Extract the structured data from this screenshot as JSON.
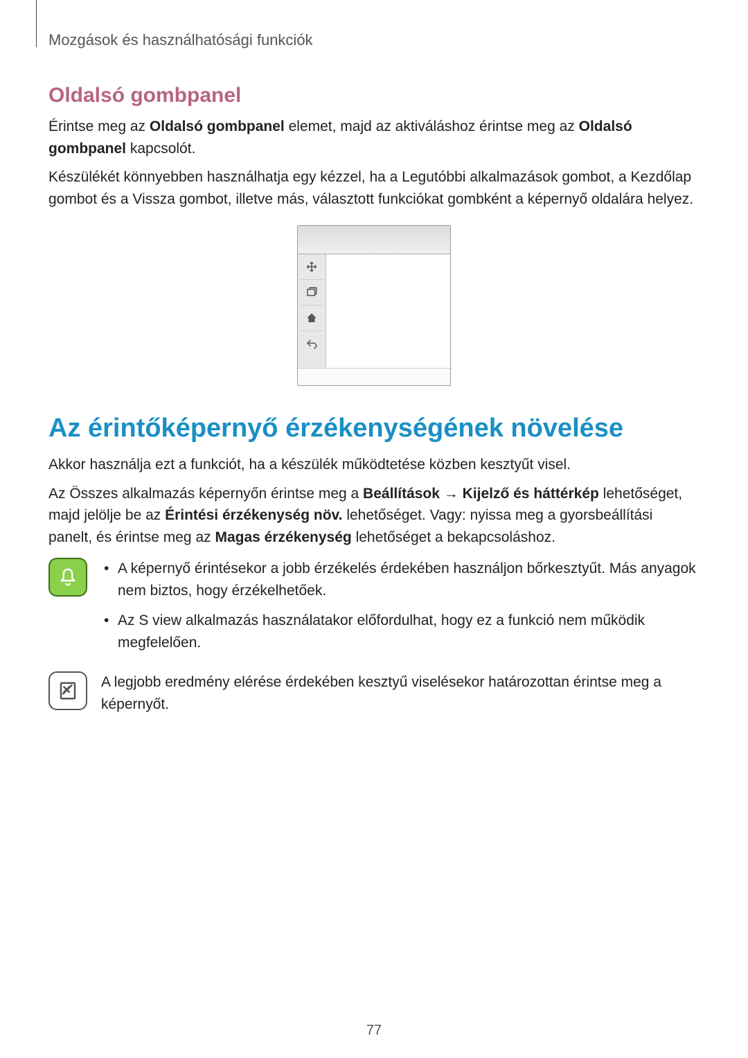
{
  "breadcrumb": "Mozgások és használhatósági funkciók",
  "section1": {
    "heading": "Oldalsó gombpanel",
    "para1_leadin": "Érintse meg az ",
    "para1_cmd": "Oldalsó gombpanel",
    "para1_mid": " elemet, majd az aktiváláshoz érintse meg az ",
    "para1_cmd2": "Oldalsó gombpanel",
    "para1_end": " kapcsolót.",
    "para2": "Készülékét könnyebben használhatja egy kézzel, ha a Legutóbbi alkalmazások gombot, a Kezdőlap gombot és a Vissza gombot, illetve más, választott funkciókat gombként a képernyő oldalára helyez."
  },
  "section2": {
    "heading": "Az érintőképernyő érzékenységének növelése",
    "para1": "Akkor használja ezt a funkciót, ha a készülék működtetése közben kesztyűt visel.",
    "para2_a": "Az Összes alkalmazás képernyőn érintse meg a ",
    "para2_b_bold": "Beállítások",
    "para2_c": " → ",
    "para2_d_bold": "Kijelző és háttérkép",
    "para2_e": " lehetőséget, majd jelölje be az ",
    "para2_f_bold": "Érintési érzékenység növ.",
    "para2_g": " lehetőséget. Vagy: nyissa meg a gyorsbeállítási panelt, és érintse meg az ",
    "para2_h_bold": "Magas érzékenység",
    "para2_i": " lehetőséget a bekapcsoláshoz.",
    "bullets": [
      "A képernyő érintésekor a jobb érzékelés érdekében használjon bőrkesztyűt. Más anyagok nem biztos, hogy érzékelhetőek.",
      "Az S view alkalmazás használatakor előfordulhat, hogy ez a funkció nem működik megfelelően."
    ],
    "tip": "A legjobb eredmény elérése érdekében kesztyű viselésekor határozottan érintse meg a képernyőt."
  },
  "page_number": "77"
}
